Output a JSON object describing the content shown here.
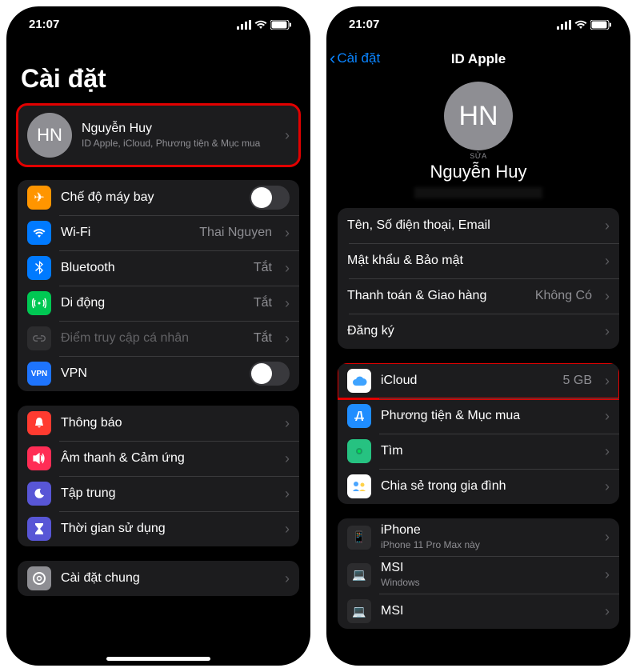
{
  "statusbar": {
    "time": "21:07"
  },
  "left": {
    "title": "Cài đặt",
    "profile": {
      "initials": "HN",
      "name": "Nguyễn Huy",
      "subtitle": "ID Apple, iCloud, Phương tiện & Mục mua"
    },
    "net": {
      "airplane": "Chế độ máy bay",
      "wifi": "Wi-Fi",
      "wifi_val": "Thai Nguyen",
      "bt": "Bluetooth",
      "bt_val": "Tắt",
      "cell": "Di động",
      "cell_val": "Tắt",
      "hotspot": "Điểm truy cập cá nhân",
      "hotspot_val": "Tắt",
      "vpn": "VPN"
    },
    "g2": {
      "notif": "Thông báo",
      "sound": "Âm thanh & Cảm ứng",
      "focus": "Tập trung",
      "screentime": "Thời gian sử dụng"
    },
    "g3": {
      "general": "Cài đặt chung"
    }
  },
  "right": {
    "back": "Cài đặt",
    "title": "ID Apple",
    "profile": {
      "initials": "HN",
      "edit": "SỬA",
      "name": "Nguyễn Huy"
    },
    "g1": {
      "contact": "Tên, Số điện thoại, Email",
      "security": "Mật khẩu & Bảo mật",
      "payment": "Thanh toán & Giao hàng",
      "payment_val": "Không Có",
      "subs": "Đăng ký"
    },
    "g2": {
      "icloud": "iCloud",
      "icloud_val": "5 GB",
      "media": "Phương tiện & Mục mua",
      "find": "Tìm",
      "family": "Chia sẻ trong gia đình"
    },
    "devices": {
      "d1_name": "iPhone",
      "d1_sub": "iPhone 11 Pro Max này",
      "d2_name": "MSI",
      "d2_sub": "Windows",
      "d3_name": "MSI"
    }
  }
}
